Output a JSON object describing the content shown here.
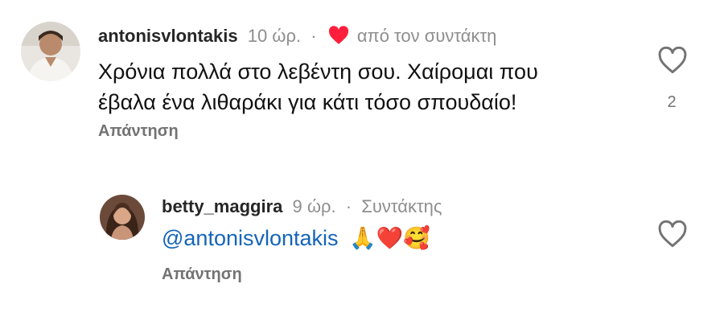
{
  "comments": [
    {
      "username": "antonisvlontakis",
      "time": "10 ώρ.",
      "separator": "·",
      "liked_by_author_label": "από τον συντάκτη",
      "text_line1": "Χρόνια πολλά στο λεβέντη σου. Χαίρομαι που",
      "text_line2": "έβαλα ένα λιθαράκι για κάτι τόσο σπουδαίο!",
      "like_count": "2",
      "reply_label": "Απάντηση",
      "icons": [
        "heart-icon",
        "outline-heart-icon"
      ]
    },
    {
      "username": "betty_maggira",
      "time": "9 ώρ.",
      "separator": "·",
      "author_badge": "Συντάκτης",
      "mention": "@antonisvlontakis",
      "emojis": "🙏❤️🥰",
      "reply_label": "Απάντηση",
      "icons": [
        "outline-heart-icon"
      ]
    }
  ],
  "colors": {
    "username": "#262626",
    "meta": "#8e8e8e",
    "mention": "#1565b8",
    "heart": "#ff1f3d",
    "reply": "#737373"
  }
}
